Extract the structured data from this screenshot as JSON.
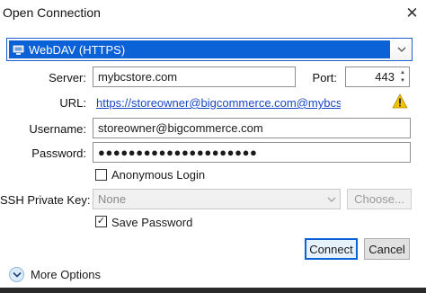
{
  "window": {
    "title": "Open Connection",
    "close_symbol": "✕"
  },
  "protocol": {
    "selected": "WebDAV (HTTPS)"
  },
  "server": {
    "label": "Server:",
    "value": "mybcstore.com"
  },
  "port": {
    "label": "Port:",
    "value": "443"
  },
  "url": {
    "label": "URL:",
    "value": "https://storeowner@bigcommerce.com@mybcst..."
  },
  "username": {
    "label": "Username:",
    "value": "storeowner@bigcommerce.com"
  },
  "password": {
    "label": "Password:",
    "value": "●●●●●●●●●●●●●●●●●●●●●"
  },
  "anonymous_login": {
    "label": "Anonymous Login",
    "checked": false
  },
  "ssh_key": {
    "label": "SSH Private Key:",
    "selected": "None",
    "choose_label": "Choose..."
  },
  "save_password": {
    "label": "Save Password",
    "checked": true,
    "check_symbol": "✓"
  },
  "buttons": {
    "connect": "Connect",
    "cancel": "Cancel"
  },
  "more_options": {
    "label": "More Options"
  },
  "colors": {
    "accent": "#0a62d6",
    "link": "#1a47c7",
    "warning": "#f2c200"
  }
}
